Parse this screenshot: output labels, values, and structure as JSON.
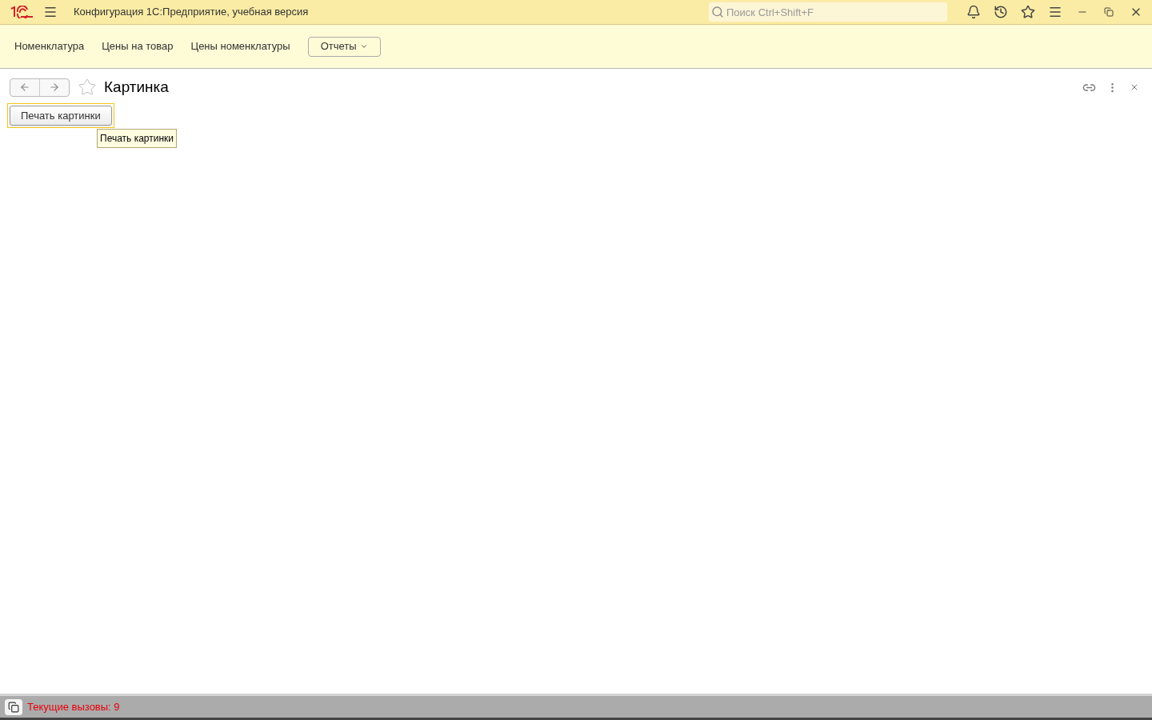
{
  "window": {
    "title": "Конфигурация 1С:Предприятие, учебная версия"
  },
  "search": {
    "placeholder": "Поиск Ctrl+Shift+F"
  },
  "sections": [
    {
      "label": "Номенклатура",
      "kind": "link"
    },
    {
      "label": "Цены на товар",
      "kind": "link"
    },
    {
      "label": "Цены номенклатуры",
      "kind": "link"
    },
    {
      "label": "Отчеты",
      "kind": "dropdown"
    }
  ],
  "form": {
    "title": "Картинка",
    "favorite": false,
    "buttons": [
      {
        "label": "Печать картинки",
        "focused": true
      }
    ],
    "tooltip": "Печать картинки"
  },
  "status_bar": {
    "text": "Текущие вызовы: 9"
  }
}
